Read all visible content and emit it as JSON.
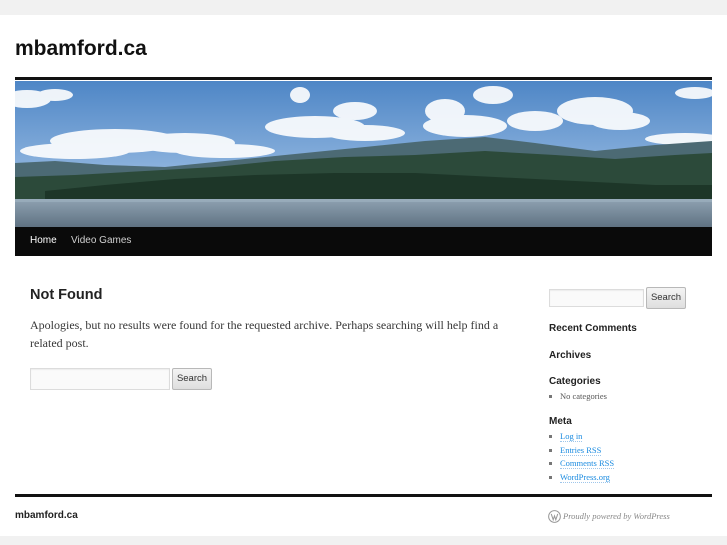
{
  "site": {
    "title": "mbamford.ca"
  },
  "nav": {
    "items": [
      {
        "label": "Home"
      },
      {
        "label": "Video Games"
      }
    ]
  },
  "main": {
    "heading": "Not Found",
    "message": "Apologies, but no results were found for the requested archive. Perhaps searching will help find a related post.",
    "search": {
      "value": "",
      "button_label": "Search"
    }
  },
  "sidebar": {
    "search": {
      "value": "",
      "button_label": "Search"
    },
    "recent_comments_title": "Recent Comments",
    "archives_title": "Archives",
    "categories": {
      "title": "Categories",
      "items": [
        "No categories"
      ]
    },
    "meta": {
      "title": "Meta",
      "items": [
        "Log in",
        "Entries RSS",
        "Comments RSS",
        "WordPress.org"
      ]
    }
  },
  "footer": {
    "site_title": "mbamford.ca",
    "powered_by": "Proudly powered by WordPress"
  },
  "colors": {
    "accent_link": "#1b8be0",
    "nav_bg": "#0a0a0a",
    "page_bg": "#f1f1f1"
  },
  "icons": {
    "footer": "wordpress-icon"
  }
}
